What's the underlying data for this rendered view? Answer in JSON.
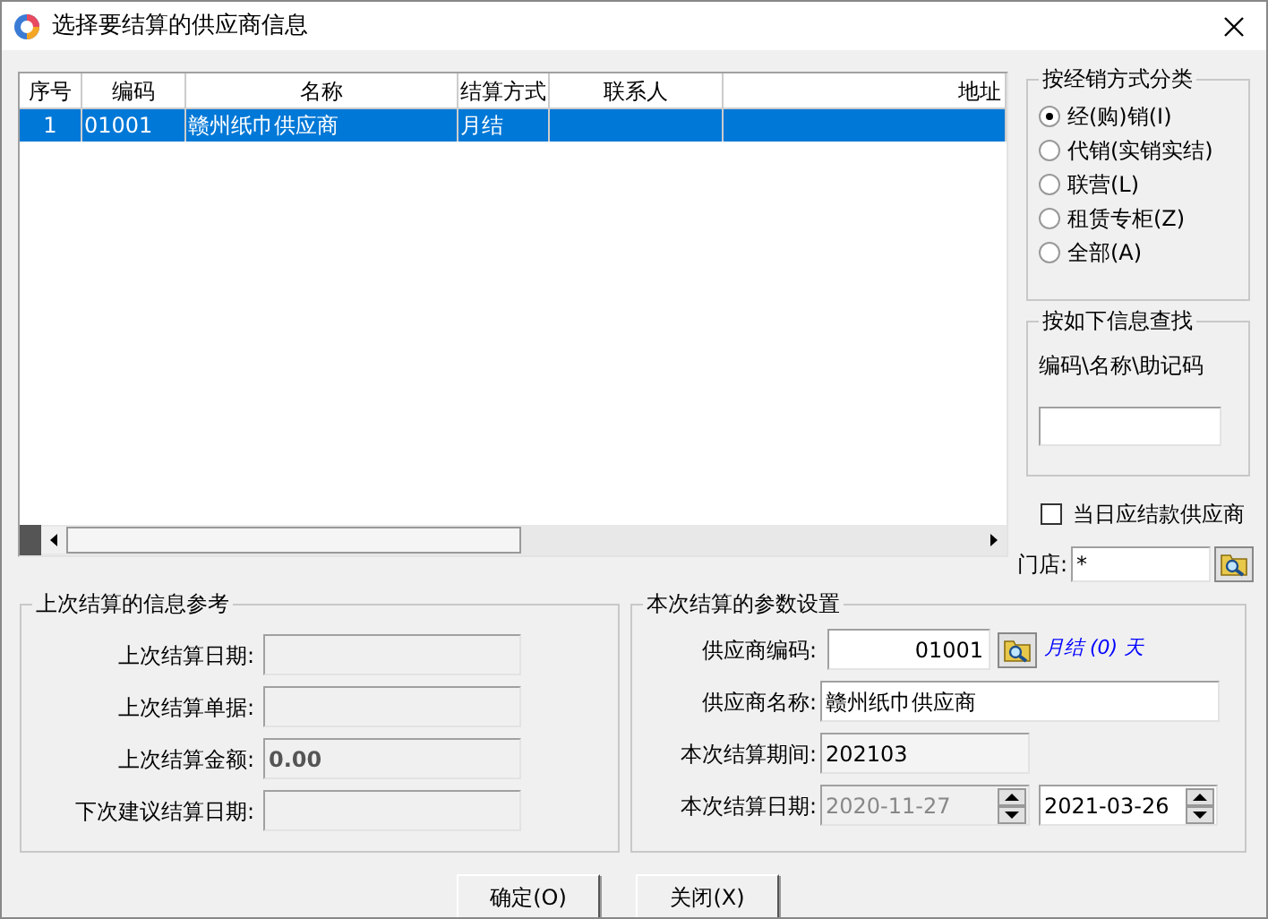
{
  "window": {
    "title": "选择要结算的供应商信息"
  },
  "table": {
    "columns": [
      "序号",
      "编码",
      "名称",
      "结算方式",
      "联系人",
      "地址"
    ],
    "rows": [
      {
        "cells": [
          "1",
          "01001",
          "赣州纸巾供应商",
          "月结",
          "",
          ""
        ],
        "selected": true
      }
    ]
  },
  "classification": {
    "title": "按经销方式分类",
    "options": [
      {
        "label": "经(购)销(I)",
        "selected": true
      },
      {
        "label": "代销(实销实结)",
        "selected": false
      },
      {
        "label": "联营(L)",
        "selected": false
      },
      {
        "label": "租赁专柜(Z)",
        "selected": false
      },
      {
        "label": "全部(A)",
        "selected": false
      }
    ]
  },
  "search": {
    "title": "按如下信息查找",
    "label": "编码\\名称\\助记码"
  },
  "due_today": {
    "label": "当日应结款供应商",
    "checked": false
  },
  "store": {
    "label": "门店:",
    "value": "*"
  },
  "last_settlement": {
    "title": "上次结算的信息参考",
    "fields": [
      {
        "label": "上次结算日期:"
      },
      {
        "label": "上次结算单据:"
      },
      {
        "label": "上次结算金额:",
        "value": "0.00"
      },
      {
        "label": "下次建议结算日期:"
      }
    ]
  },
  "current_settlement": {
    "title": "本次结算的参数设置",
    "fields": [
      {
        "kind": "code",
        "label": "供应商编码:",
        "value": "01001",
        "hint": "月结 (0) 天"
      },
      {
        "kind": "text",
        "label": "供应商名称:",
        "value": "赣州纸巾供应商",
        "readonly": false
      },
      {
        "kind": "text",
        "label": "本次结算期间:",
        "value": "202103",
        "readonly": true
      },
      {
        "kind": "dates",
        "label": "本次结算日期:",
        "from": "2020-11-27",
        "from_disabled": true,
        "to": "2021-03-26"
      }
    ]
  },
  "buttons": [
    "确定(O)",
    "关闭(X)"
  ]
}
